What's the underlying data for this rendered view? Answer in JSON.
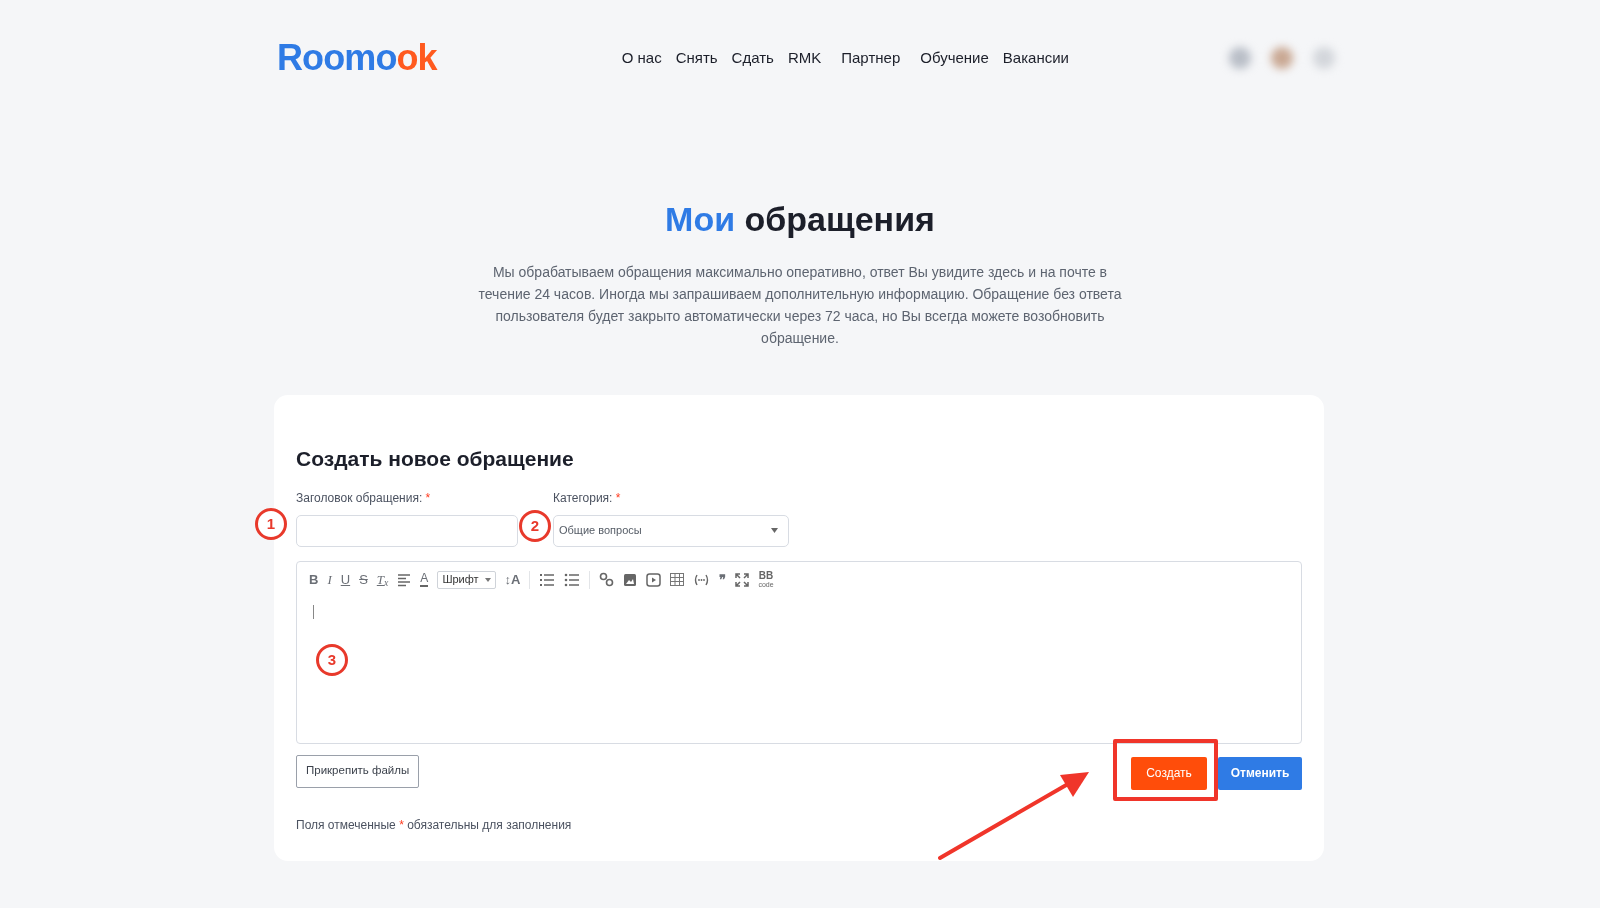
{
  "header": {
    "logo": {
      "main": "Roomo",
      "accent": "ok"
    },
    "nav": [
      "О нас",
      "Снять",
      "Сдать",
      "RMK",
      "Партнер",
      "Обучение",
      "Вакансии"
    ]
  },
  "hero": {
    "title_accent": "Мои",
    "title_rest": "обращения",
    "description": "Мы обрабатываем обращения максимально оперативно, ответ Вы увидите здесь и на почте в течение 24 часов. Иногда мы запрашиваем дополнительную информацию. Обращение без ответа пользователя будет закрыто автоматически через 72 часа, но Вы всегда можете возобновить обращение."
  },
  "form": {
    "heading": "Создать новое обращение",
    "subject": {
      "label": "Заголовок обращения:",
      "required_mark": "*"
    },
    "category": {
      "label": "Категория:",
      "required_mark": "*",
      "value": "Общие вопросы"
    },
    "toolbar": [
      {
        "kind": "bold",
        "label": "B"
      },
      {
        "kind": "italic",
        "label": "I"
      },
      {
        "kind": "underline",
        "label": "U"
      },
      {
        "kind": "strike",
        "label": "S"
      },
      {
        "kind": "clear",
        "label": "T$_{x}$"
      },
      {
        "kind": "icon"
      },
      {
        "kind": "color",
        "label": "A"
      },
      {
        "kind": "dropdown",
        "label": "Шрифт"
      },
      {
        "kind": "plain",
        "label": "↕A"
      },
      {
        "kind": "separator"
      },
      {
        "kind": "icon"
      },
      {
        "kind": "icon"
      },
      {
        "kind": "separator"
      },
      {
        "kind": "icon"
      },
      {
        "kind": "icon"
      },
      {
        "kind": "icon"
      },
      {
        "kind": "icon"
      },
      {
        "kind": "icon"
      },
      {
        "kind": "plain",
        "label": "❞"
      },
      {
        "kind": "icon"
      },
      {
        "kind": "bbcode",
        "label": "BB",
        "sub": "code"
      }
    ],
    "attach_button": "Прикрепить файлы",
    "create_button": "Создать",
    "cancel_button": "Отменить",
    "footnote_before": "Поля отмеченные",
    "footnote_mark": "*",
    "footnote_after": "обязательны для заполнения"
  },
  "annotations": [
    "1",
    "2",
    "3"
  ]
}
